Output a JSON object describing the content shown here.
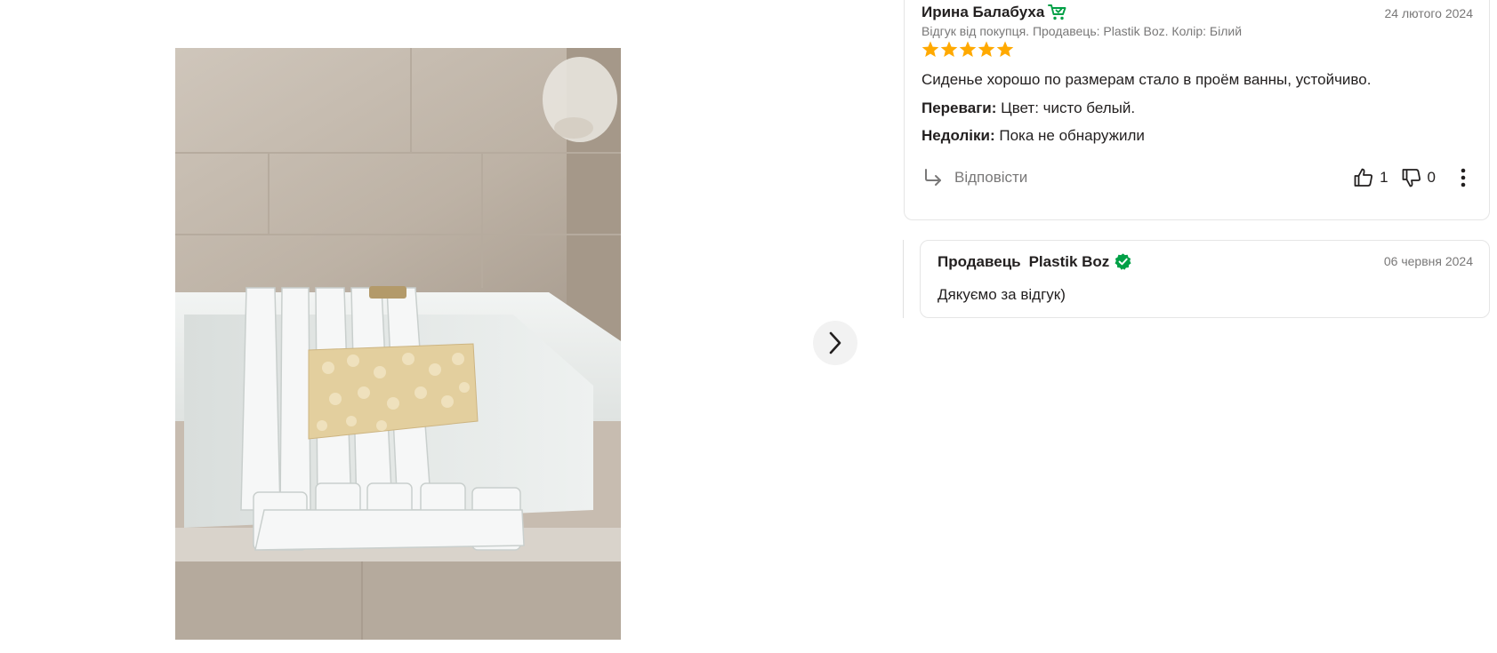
{
  "photo": {
    "alt": "Сиденье для ванны"
  },
  "navigation": {
    "next_icon": "chevron-right-icon"
  },
  "review": {
    "author": "Ирина Балабуха",
    "buyer_icon": "cart-check-icon",
    "date": "24 лютого 2024",
    "meta": "Відгук від покупця. Продавець: Plastik Boz. Колір: Білий",
    "rating": 5,
    "rating_max": 5,
    "text": "Сиденье хорошо по размерам стало в проём ванны, устойчиво.",
    "pros_label": "Переваги:",
    "pros_value": "Цвет: чисто белый.",
    "cons_label": "Недоліки:",
    "cons_value": "Пока не обнаружили",
    "reply_label": "Відповісти",
    "likes": "1",
    "dislikes": "0"
  },
  "seller_answer": {
    "label": "Продавець",
    "seller": "Plastik Boz",
    "date": "06 червня 2024",
    "text": "Дякуємо за відгук)"
  },
  "colors": {
    "star": "#ffa900",
    "verified": "#00a046",
    "muted_text": "#797878",
    "text": "#221f1f"
  }
}
